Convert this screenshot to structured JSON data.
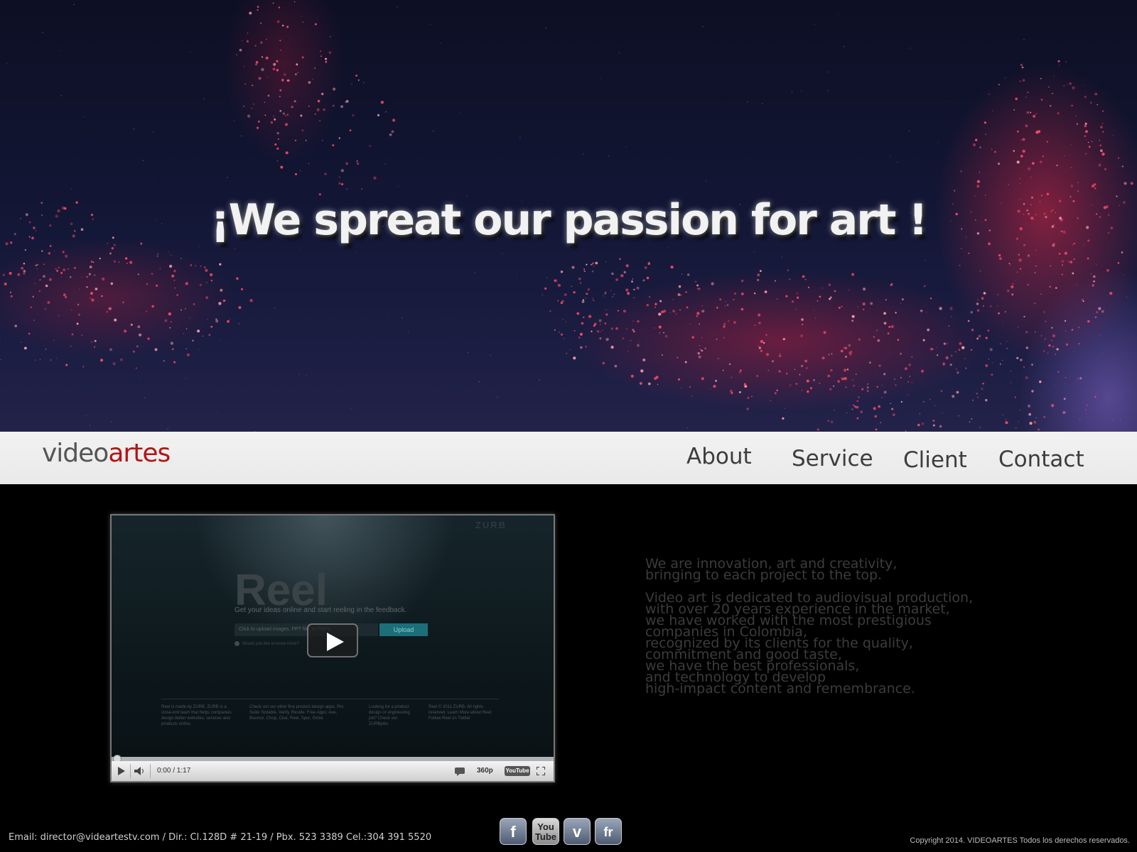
{
  "hero": {
    "headline": "¡We spreat our passion for art !"
  },
  "nav": {
    "logo_part1": "video",
    "logo_part2": "artes",
    "items": [
      "About",
      "Service",
      "Client",
      "Contact"
    ]
  },
  "video": {
    "watermark": "ZURB",
    "title": "Reel",
    "subtitle": "Get your ideas online and start reeling in the feedback.",
    "upload_placeholder": "Click to upload images, PPT file, or PDFs",
    "upload_button": "Upload",
    "info_text": "Would you like to know more?",
    "footer_col1": "Reel is made by ZURB. ZURB is a close-knit team that helps companies design better websites, services and products online.",
    "footer_col2": "Check out our other fine product design apps. Pro Suite: Notable, Verify, Reside. Free Apps: Axe, Bounce, Chop, Clue, Reel, Spur, Strike",
    "footer_col3": "Looking for a product design or engineering job? Check out ZURBjobs",
    "footer_col4": "Reel © 2011 ZURB. All rights reserved. Learn More about Reel. Follow Reel on Twitter",
    "time": "0:00 / 1:17",
    "quality": "360p",
    "yt_label": "YouTube",
    "progress": 0
  },
  "about": {
    "paragraph1": "We are innovation, art and creativity,\nbringing to each project to the top.",
    "paragraph2": "Video art is dedicated to audiovisual production,\nwith over 20 years experience in the market,\nwe have worked with the most prestigious\ncompanies in Colombia,\nrecognized by its clients for the quality,\ncommitment and good taste,\nwe have the best professionals,\nand technology to develop\nhigh-impact content and remembrance."
  },
  "footer": {
    "contact": "Email: director@videartestv.com / Dir.: Cl.128D # 21-19 / Pbx. 523 3389 Cel.:304 391 5520",
    "social": [
      {
        "icon": "facebook-icon",
        "glyph": "f"
      },
      {
        "icon": "youtube-icon",
        "glyph": "You Tube"
      },
      {
        "icon": "vimeo-icon",
        "glyph": "v"
      },
      {
        "icon": "flickr-icon",
        "glyph": "fr"
      }
    ],
    "copyright": "Copyright  2014. VIDEOARTES Todos los derechos reservados."
  },
  "colors": {
    "brand_red": "#b31414",
    "nav_bg": "#efefef",
    "page_bg": "#000000"
  }
}
